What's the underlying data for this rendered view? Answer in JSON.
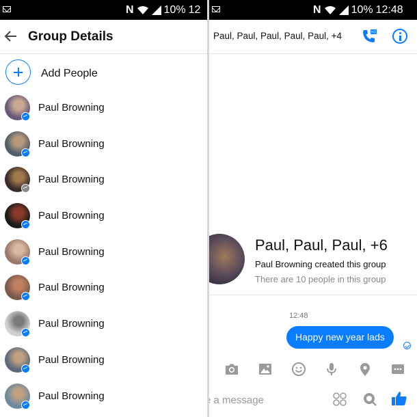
{
  "left": {
    "status": {
      "battery": "10%",
      "time": "12"
    },
    "header": {
      "title": "Group Details"
    },
    "add_people": "Add People",
    "people": [
      {
        "name": "Paul Browning",
        "badge": "messenger",
        "avatar": [
          "#6a5a7a",
          "#c9a98f"
        ]
      },
      {
        "name": "Paul Browning",
        "badge": "messenger",
        "avatar": [
          "#4f5f6a",
          "#b89a7a"
        ]
      },
      {
        "name": "Paul Browning",
        "badge": "facebook",
        "avatar": [
          "#3a2a2a",
          "#a07a4a"
        ]
      },
      {
        "name": "Paul Browning",
        "badge": "messenger",
        "avatar": [
          "#1a1a1a",
          "#8a3a2a"
        ]
      },
      {
        "name": "Paul Browning",
        "badge": "messenger",
        "avatar": [
          "#9a7a6a",
          "#d8b8a0"
        ]
      },
      {
        "name": "Paul Browning",
        "badge": "messenger",
        "avatar": [
          "#7a5a4a",
          "#c08060"
        ]
      },
      {
        "name": "Paul Browning",
        "badge": "messenger",
        "avatar": [
          "#d0d0d0",
          "#7a7a7a"
        ]
      },
      {
        "name": "Paul Browning",
        "badge": "messenger",
        "avatar": [
          "#5a6a7a",
          "#c0a080"
        ]
      },
      {
        "name": "Paul Browning",
        "badge": "messenger",
        "avatar": [
          "#6a8aa0",
          "#c0a080"
        ]
      }
    ]
  },
  "right": {
    "status": {
      "battery": "10%",
      "time": "12:48"
    },
    "header": {
      "title": "Paul, Paul, Paul, Paul, Paul, +4"
    },
    "group": {
      "name": "Paul, Paul, Paul, +6",
      "created": "Paul Browning created this group",
      "count": "There are 10 people in this group"
    },
    "timestamp": "12:48",
    "message": "Happy new year lads",
    "composer": {
      "placeholder": "e a message",
      "icons": [
        "camera-icon",
        "image-icon",
        "emoji-icon",
        "mic-icon",
        "location-icon",
        "more-icon"
      ]
    }
  },
  "colors": {
    "accent": "#0a7cff",
    "statusbar": "#000000"
  }
}
